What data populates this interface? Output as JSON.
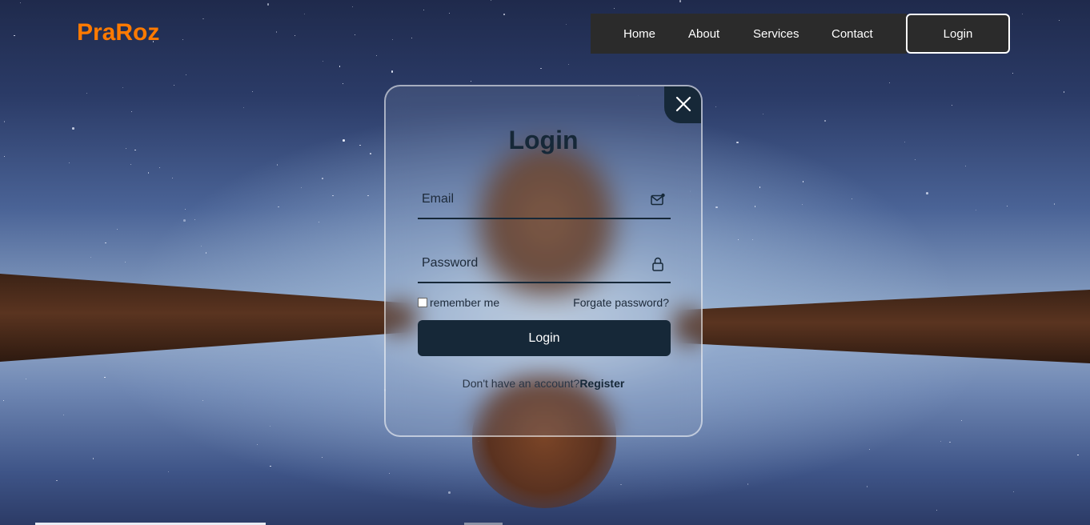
{
  "brand": {
    "logo": "PraRoz",
    "logo_color": "#ff7a00"
  },
  "nav": {
    "links": [
      {
        "label": "Home"
      },
      {
        "label": "About"
      },
      {
        "label": "Services"
      },
      {
        "label": "Contact"
      }
    ],
    "login_label": "Login"
  },
  "modal": {
    "title": "Login",
    "close_icon": "close-icon",
    "email": {
      "placeholder": "Email",
      "value": "",
      "icon": "mail-icon"
    },
    "password": {
      "placeholder": "Password",
      "value": "",
      "icon": "lock-icon"
    },
    "remember_label": "remember me",
    "remember_checked": false,
    "forgot_label": "Forgate password?",
    "submit_label": "Login",
    "register_prompt": "Don't have an account?",
    "register_link": "Register",
    "accent_color": "#162838"
  }
}
